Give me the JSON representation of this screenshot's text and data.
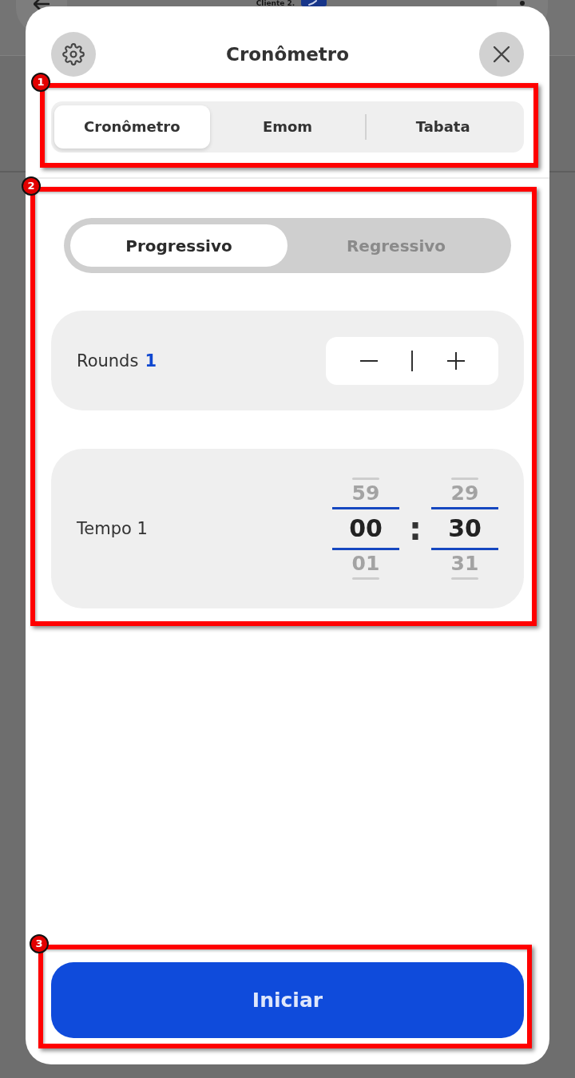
{
  "background_screen": {
    "title": "Cliente 2."
  },
  "dialog": {
    "title": "Cronômetro"
  },
  "annotations": [
    {
      "number": "1"
    },
    {
      "number": "2"
    },
    {
      "number": "3"
    }
  ],
  "mode_tabs": [
    {
      "label": "Cronômetro",
      "selected": true
    },
    {
      "label": "Emom",
      "selected": false
    },
    {
      "label": "Tabata",
      "selected": false
    }
  ],
  "direction_toggle": [
    {
      "label": "Progressivo",
      "selected": true
    },
    {
      "label": "Regressivo",
      "selected": false
    }
  ],
  "rounds": {
    "label": "Rounds",
    "value": "1"
  },
  "time": {
    "label": "Tempo 1",
    "separator": ":",
    "columns": [
      {
        "previous": "59",
        "current": "00",
        "next": "01"
      },
      {
        "previous": "29",
        "current": "30",
        "next": "31"
      }
    ]
  },
  "start_button": {
    "label": "Iniciar"
  }
}
